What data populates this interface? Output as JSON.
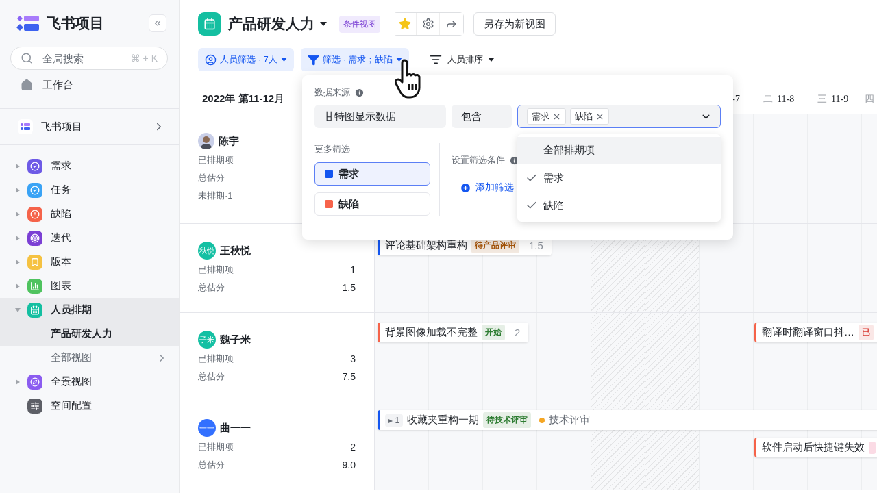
{
  "sidebar": {
    "brand": "飞书项目",
    "search": {
      "placeholder": "全局搜索",
      "shortcut": "⌘ + K"
    },
    "workbench": "工作台",
    "space": "飞书项目",
    "items": [
      {
        "label": "需求",
        "kind": "group",
        "expanded": false,
        "selected": false,
        "color": "#6d5ae6"
      },
      {
        "label": "任务",
        "kind": "group",
        "expanded": false,
        "selected": false,
        "color": "#3aa3f5"
      },
      {
        "label": "缺陷",
        "kind": "group",
        "expanded": false,
        "selected": false,
        "color": "#f5634a"
      },
      {
        "label": "迭代",
        "kind": "group",
        "expanded": false,
        "selected": false,
        "color": "#7b3fd4"
      },
      {
        "label": "版本",
        "kind": "group",
        "expanded": false,
        "selected": false,
        "color": "#f5c242"
      },
      {
        "label": "图表",
        "kind": "group",
        "expanded": false,
        "selected": false,
        "color": "#4fc35f"
      },
      {
        "label": "人员排期",
        "kind": "group",
        "expanded": true,
        "selected": true,
        "color": "#14bfa1",
        "children": [
          {
            "label": "产品研发人力",
            "kind": "view",
            "selected": true
          },
          {
            "label": "全部视图",
            "kind": "more",
            "selected": false
          }
        ]
      },
      {
        "label": "全景视图",
        "kind": "group",
        "expanded": false,
        "selected": false,
        "color": "#8b5cf0"
      },
      {
        "label": "空间配置",
        "kind": "plain",
        "selected": false,
        "color": "#5d5f66"
      }
    ]
  },
  "header": {
    "title": "产品研发人力",
    "view_tag": "条件视图",
    "starred": true,
    "save_button": "另存为新视图"
  },
  "toolbar": {
    "people_filter": "人员筛选 · 7人",
    "filter": "筛选 · 需求；缺陷",
    "sort": "人员排序"
  },
  "gantt": {
    "period": "2022年 第11-12月",
    "day_headers": [
      {
        "date": "-7"
      },
      {
        "weekday": "二",
        "date": "11-8"
      },
      {
        "weekday": "三",
        "date": "11-9"
      },
      {
        "weekday": "四"
      }
    ],
    "people": [
      {
        "name": "陈宇",
        "avatar": {
          "kind": "photo"
        },
        "stats": [
          {
            "label": "已排期项"
          },
          {
            "label": "总估分"
          },
          {
            "label": "未排期·1"
          }
        ]
      },
      {
        "name": "王秋悦",
        "avatar": {
          "kind": "initials",
          "text": "秋悦",
          "color": "#14c0a3"
        },
        "stats": [
          {
            "label": "已排期项",
            "value": "1"
          },
          {
            "label": "总估分",
            "value": "1.5"
          }
        ],
        "bars": [
          {
            "title": "评论基础架构重构",
            "color": "#1456f0",
            "tag": {
              "text": "待产品评审",
              "color": "#a8560a"
            },
            "points": "1.5"
          }
        ]
      },
      {
        "name": "魏子米",
        "avatar": {
          "kind": "initials",
          "text": "子米",
          "color": "#14c0a3"
        },
        "stats": [
          {
            "label": "已排期项",
            "value": "3"
          },
          {
            "label": "总估分",
            "value": "7.5"
          }
        ],
        "bars": [
          {
            "title": "背景图像加载不完整",
            "color": "#f5634a",
            "tag": {
              "text": "开始",
              "color": "#2e7d32"
            },
            "points": "2"
          },
          {
            "title": "翻译时翻译窗口抖…",
            "color": "#f5634a",
            "tag": {
              "text": "已",
              "color": "#d83931"
            }
          }
        ]
      },
      {
        "name": "曲一一",
        "avatar": {
          "kind": "initials",
          "text": "一一",
          "color": "#3370ff"
        },
        "stats": [
          {
            "label": "已排期项",
            "value": "2"
          },
          {
            "label": "总估分",
            "value": "9.0"
          }
        ],
        "bars": [
          {
            "title": "收藏夹重构一期",
            "color": "#1456f0",
            "expand_toggle": {
              "icon": "▸",
              "count": "1"
            },
            "tag": {
              "text": "待技术评审",
              "color": "#2e7d32"
            },
            "status": {
              "text": "技术评审",
              "color": "#f5a623"
            }
          },
          {
            "title": "软件启动后快捷键失效",
            "color": "#f5634a",
            "tag": {
              "color": "#fbdbe5"
            }
          }
        ]
      }
    ]
  },
  "filter_panel": {
    "source_label": "数据来源",
    "source_field": "甘特图显示数据",
    "operator": "包含",
    "values": [
      {
        "label": "需求"
      },
      {
        "label": "缺陷"
      }
    ],
    "more_label": "更多筛选",
    "types": [
      {
        "label": "需求",
        "color": "#1456f0",
        "selected": true
      },
      {
        "label": "缺陷",
        "color": "#f7634b",
        "selected": false
      }
    ],
    "conditions_label": "设置筛选条件",
    "add_filter": "添加筛选",
    "options": [
      {
        "label": "全部排期项",
        "checked": false,
        "hovered": true
      },
      {
        "label": "需求",
        "checked": true,
        "hovered": false
      },
      {
        "label": "缺陷",
        "checked": true,
        "hovered": false
      }
    ]
  }
}
